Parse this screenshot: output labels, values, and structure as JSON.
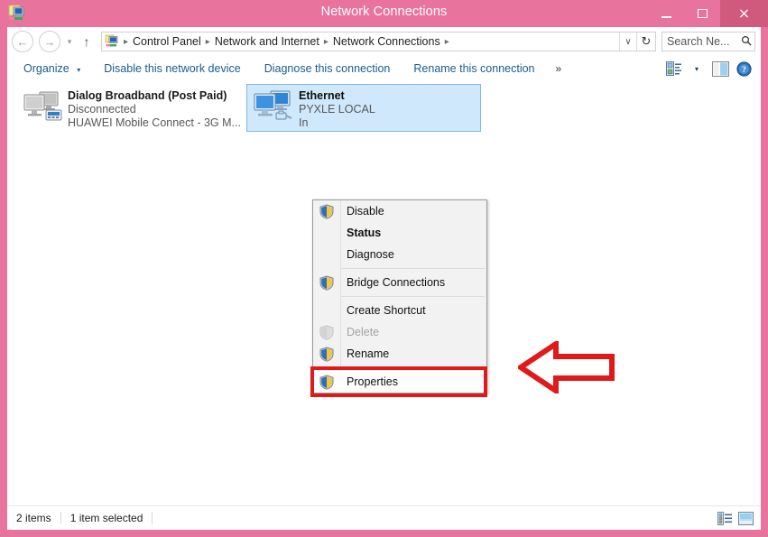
{
  "window": {
    "title": "Network Connections",
    "icon": "network-connections-icon",
    "controls": {
      "minimize": "minimize-button",
      "maximize": "maximize-button",
      "close": "close-button",
      "close_glyph": "×"
    },
    "frame_color": "#e8749e",
    "close_color": "#d05a7d"
  },
  "address_bar": {
    "back": "←",
    "forward": "→",
    "recent_caret": "▾",
    "up": "↑",
    "breadcrumb_icon": "control-panel-icon",
    "crumbs": [
      "Control Panel",
      "Network and Internet",
      "Network Connections"
    ],
    "separator": "▸",
    "history_caret": "∨",
    "refresh": "↻",
    "search_placeholder": "Search Ne...",
    "search_value": "",
    "search_icon": "🔍"
  },
  "toolbar": {
    "organize": "Organize",
    "organize_caret": "▾",
    "disable_device": "Disable this network device",
    "diagnose": "Diagnose this connection",
    "rename": "Rename this connection",
    "overflow": "»",
    "view_caret": "▾",
    "icons": {
      "change_view": "change-view-icon",
      "preview_pane": "preview-pane-icon",
      "help": "help-icon"
    }
  },
  "connections": [
    {
      "name": "Dialog Broadband (Post Paid)",
      "status": "Disconnected",
      "device": "HUAWEI Mobile Connect - 3G M...",
      "icon": "modem-connection-icon",
      "selected": false
    },
    {
      "name": "Ethernet",
      "status": "PYXLE LOCAL",
      "device": "In",
      "icon": "ethernet-connection-icon",
      "selected": true
    }
  ],
  "context_menu": {
    "items": [
      {
        "label": "Disable",
        "icon": "shield",
        "bold": false,
        "disabled": false,
        "sep_after": false,
        "highlight": false
      },
      {
        "label": "Status",
        "icon": "none",
        "bold": true,
        "disabled": false,
        "sep_after": false,
        "highlight": false
      },
      {
        "label": "Diagnose",
        "icon": "none",
        "bold": false,
        "disabled": false,
        "sep_after": true,
        "highlight": false
      },
      {
        "label": "Bridge Connections",
        "icon": "shield",
        "bold": false,
        "disabled": false,
        "sep_after": true,
        "highlight": false
      },
      {
        "label": "Create Shortcut",
        "icon": "none",
        "bold": false,
        "disabled": false,
        "sep_after": false,
        "highlight": false
      },
      {
        "label": "Delete",
        "icon": "shield-disabled",
        "bold": false,
        "disabled": true,
        "sep_after": false,
        "highlight": false
      },
      {
        "label": "Rename",
        "icon": "shield",
        "bold": false,
        "disabled": false,
        "sep_after": true,
        "highlight": false
      },
      {
        "label": "Properties",
        "icon": "shield",
        "bold": false,
        "disabled": false,
        "sep_after": false,
        "highlight": true
      }
    ]
  },
  "annotation": {
    "highlight_color": "#e01a1a",
    "arrow_direction": "left",
    "arrow_label": "points-to-properties"
  },
  "status_bar": {
    "item_count": "2 items",
    "selection": "1 item selected",
    "details_view_icon": "details-view-icon",
    "large_icons_view_icon": "large-icons-view-icon"
  }
}
